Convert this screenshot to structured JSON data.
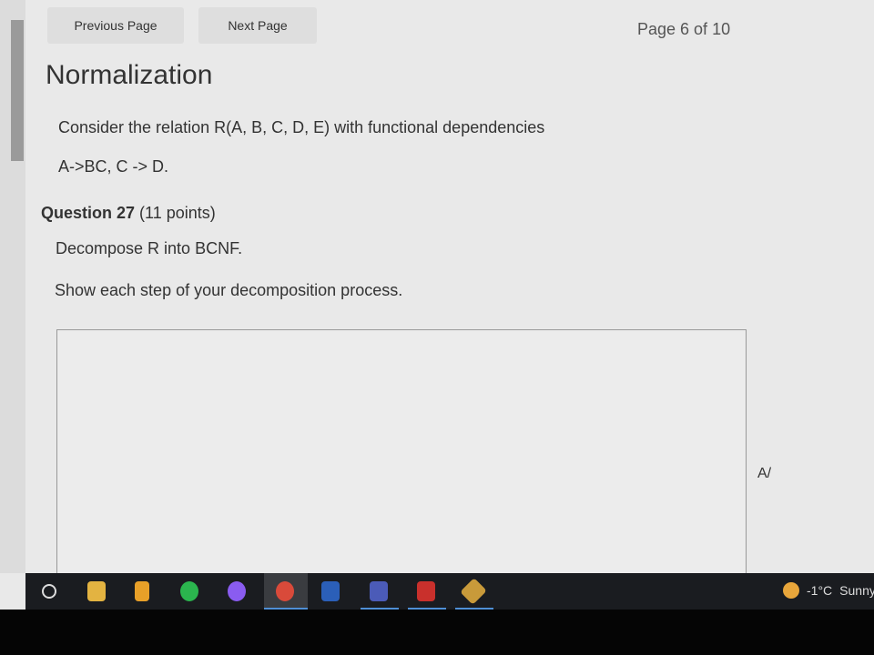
{
  "nav": {
    "previous": "Previous Page",
    "next": "Next Page",
    "page_indicator": "Page 6 of 10"
  },
  "section": {
    "title": "Normalization",
    "intro_line1": "Consider the relation R(A, B, C, D, E) with functional dependencies",
    "intro_line2": "A->BC, C -> D."
  },
  "question": {
    "label": "Question 27",
    "points": "(11 points)",
    "prompt1": "Decompose R into BCNF.",
    "prompt2": "Show each step of your decomposition process.",
    "answer": ""
  },
  "taskbar": {
    "apps": [
      "search-icon",
      "file-explorer-icon",
      "google-keep-icon",
      "spotify-icon",
      "messenger-icon",
      "chrome-icon",
      "word-icon",
      "teams-icon",
      "acrobat-icon",
      "git-icon"
    ],
    "weather": {
      "temp": "-1°C",
      "condition": "Sunny"
    }
  }
}
